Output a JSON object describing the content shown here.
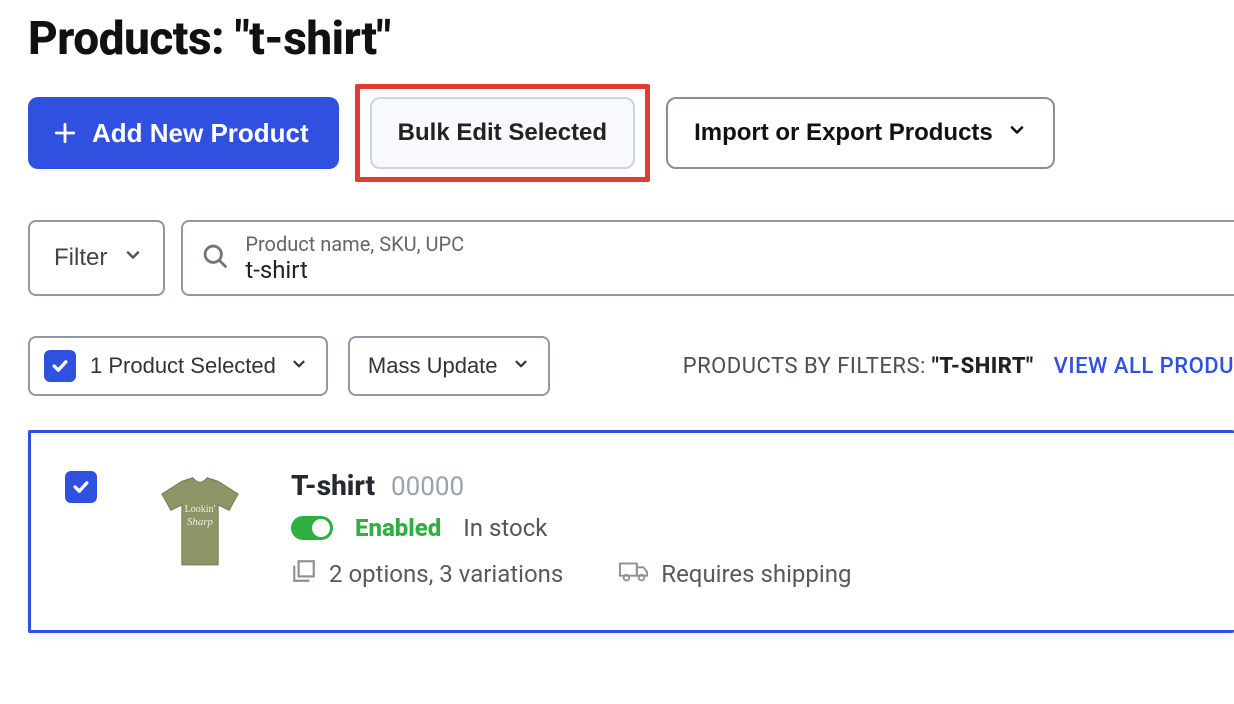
{
  "page": {
    "title_prefix": "Products: ",
    "title_query": "\"t-shirt\""
  },
  "toolbar": {
    "add_label": "Add New Product",
    "bulk_edit_label": "Bulk Edit Selected",
    "import_export_label": "Import or Export Products"
  },
  "filter": {
    "filter_button_label": "Filter",
    "search_label": "Product name, SKU, UPC",
    "search_value": "t-shirt"
  },
  "selection": {
    "selected_label": "1 Product Selected",
    "mass_update_label": "Mass Update",
    "filter_summary_label": "PRODUCTS BY FILTERS: ",
    "filter_term": "\"T-SHIRT\"",
    "view_all_label": "VIEW ALL PRODU"
  },
  "product": {
    "name": "T-shirt",
    "sku": "00000",
    "enabled_label": "Enabled",
    "stock_label": "In stock",
    "options_label": "2 options, 3 variations",
    "shipping_label": "Requires shipping"
  },
  "colors": {
    "primary": "#3050e0",
    "highlight": "#e03c31",
    "enabled": "#2eaf3f"
  }
}
